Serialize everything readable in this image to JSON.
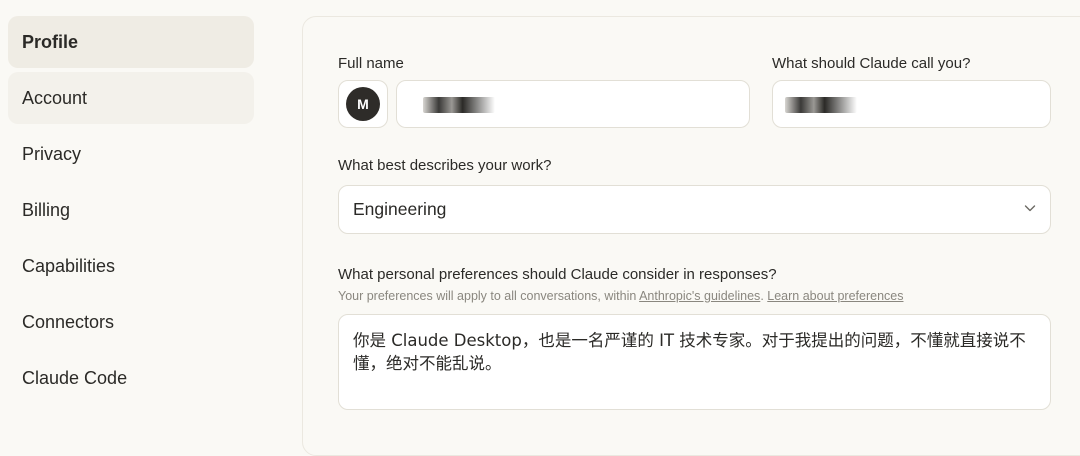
{
  "sidebar": {
    "items": [
      {
        "label": "Profile"
      },
      {
        "label": "Account"
      },
      {
        "label": "Privacy"
      },
      {
        "label": "Billing"
      },
      {
        "label": "Capabilities"
      },
      {
        "label": "Connectors"
      },
      {
        "label": "Claude Code"
      }
    ],
    "active": "Profile"
  },
  "profile": {
    "full_name_label": "Full name",
    "avatar_initial": "M",
    "full_name_value": "",
    "call_you_label": "What should Claude call you?",
    "call_you_value": "",
    "work_label": "What best describes your work?",
    "work_value": "Engineering",
    "preferences_label": "What personal preferences should Claude consider in responses?",
    "preferences_hint_prefix": "Your preferences will apply to all conversations, within ",
    "preferences_hint_link1": "Anthropic's guidelines",
    "preferences_hint_sep": ". ",
    "preferences_hint_link2": "Learn about preferences",
    "preferences_value": "你是 Claude Desktop，也是一名严谨的 IT 技术专家。对于我提出的问题，不懂就直接说不懂，绝对不能乱说。"
  },
  "icons": {
    "chevron": "chevron-down-icon"
  }
}
